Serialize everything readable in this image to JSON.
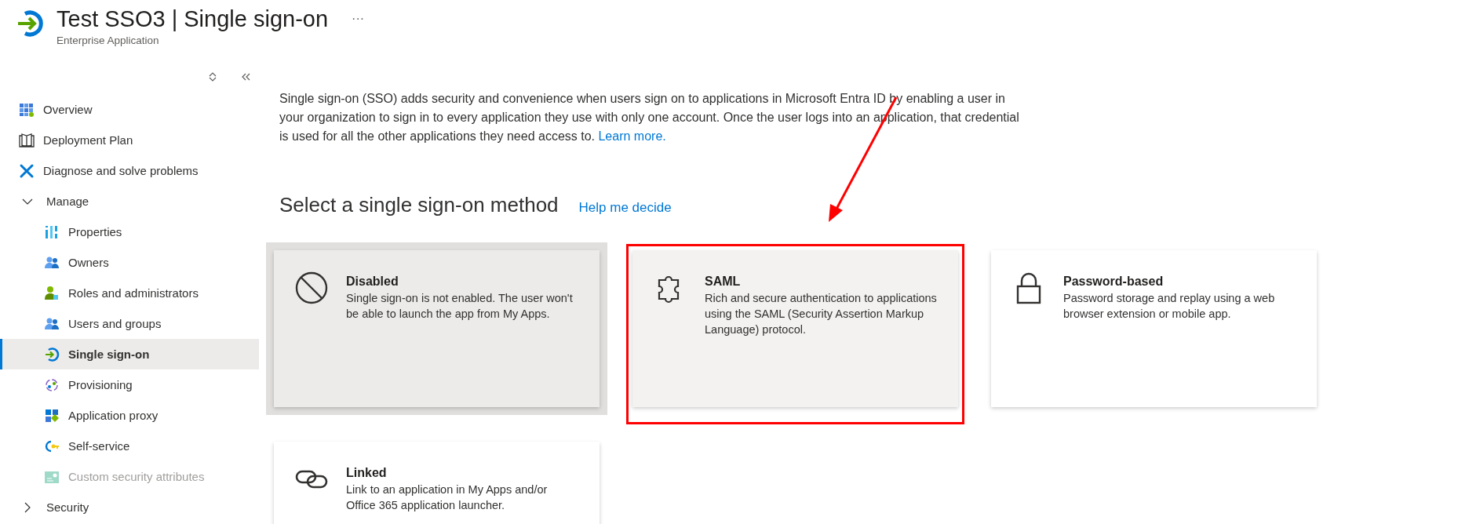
{
  "header": {
    "title": "Test SSO3 | Single sign-on",
    "subtitle": "Enterprise Application",
    "more": "···"
  },
  "sidebar": {
    "items": [
      {
        "label": "Overview",
        "kind": "link",
        "selected": false,
        "disabled": false
      },
      {
        "label": "Deployment Plan",
        "kind": "link",
        "selected": false,
        "disabled": false
      },
      {
        "label": "Diagnose and solve problems",
        "kind": "link",
        "selected": false,
        "disabled": false
      },
      {
        "label": "Manage",
        "kind": "group",
        "expanded": true,
        "selected": false,
        "disabled": false,
        "children": [
          {
            "label": "Properties",
            "kind": "link",
            "selected": false,
            "disabled": false
          },
          {
            "label": "Owners",
            "kind": "link",
            "selected": false,
            "disabled": false
          },
          {
            "label": "Roles and administrators",
            "kind": "link",
            "selected": false,
            "disabled": false
          },
          {
            "label": "Users and groups",
            "kind": "link",
            "selected": false,
            "disabled": false
          },
          {
            "label": "Single sign-on",
            "kind": "link",
            "selected": true,
            "disabled": false
          },
          {
            "label": "Provisioning",
            "kind": "link",
            "selected": false,
            "disabled": false
          },
          {
            "label": "Application proxy",
            "kind": "link",
            "selected": false,
            "disabled": false
          },
          {
            "label": "Self-service",
            "kind": "link",
            "selected": false,
            "disabled": false
          },
          {
            "label": "Custom security attributes",
            "kind": "link",
            "selected": false,
            "disabled": true
          }
        ]
      },
      {
        "label": "Security",
        "kind": "group",
        "expanded": false,
        "selected": false,
        "disabled": false
      }
    ]
  },
  "intro": {
    "text": "Single sign-on (SSO) adds security and convenience when users sign on to applications in Microsoft Entra ID by enabling a user in your organization to sign in to every application they use with only one account. Once the user logs into an application, that credential is used for all the other applications they need access to.",
    "link": "Learn more."
  },
  "section": {
    "title": "Select a single sign-on method",
    "link": "Help me decide"
  },
  "methods": [
    {
      "title": "Disabled",
      "description": "Single sign-on is not enabled. The user won't be able to launch the app from My Apps.",
      "selected": true,
      "hovered": false,
      "annotated": false
    },
    {
      "title": "SAML",
      "description": "Rich and secure authentication to applications using the SAML (Security Assertion Markup Language) protocol.",
      "selected": false,
      "hovered": true,
      "annotated": true
    },
    {
      "title": "Password-based",
      "description": "Password storage and replay using a web browser extension or mobile app.",
      "selected": false,
      "hovered": false,
      "annotated": false
    },
    {
      "title": "Linked",
      "description": "Link to an application in My Apps and/or Office 365 application launcher.",
      "selected": false,
      "hovered": false,
      "annotated": false
    }
  ],
  "annotation": {
    "arrow": true
  }
}
